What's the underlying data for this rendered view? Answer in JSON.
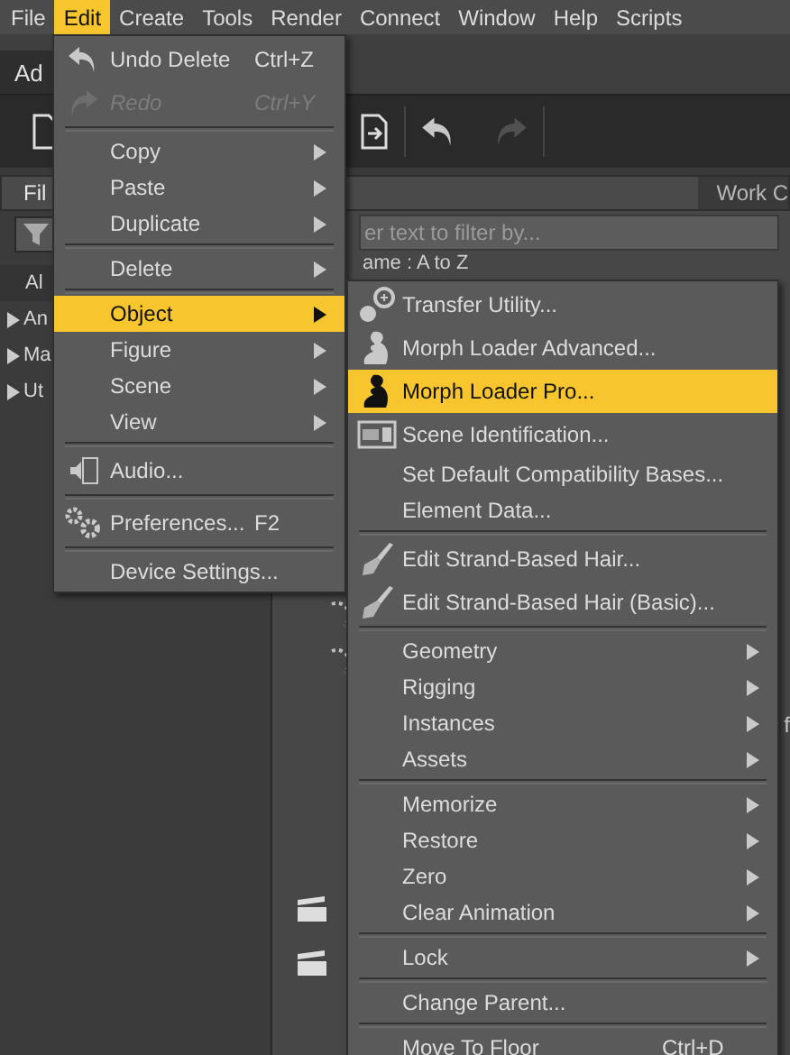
{
  "menu_bar": [
    {
      "label": "File",
      "selected": false
    },
    {
      "label": "Edit",
      "selected": true
    },
    {
      "label": "Create",
      "selected": false
    },
    {
      "label": "Tools",
      "selected": false
    },
    {
      "label": "Render",
      "selected": false
    },
    {
      "label": "Connect",
      "selected": false
    },
    {
      "label": "Window",
      "selected": false
    },
    {
      "label": "Help",
      "selected": false
    },
    {
      "label": "Scripts",
      "selected": false
    }
  ],
  "workspace": {
    "tab": "Ad",
    "panel_tabs": [
      {
        "label": "Fil",
        "selected": true
      },
      {
        "label": "Work C",
        "selected": false
      }
    ],
    "filter_placeholder": "er text to filter by...",
    "sort_label": "ame : A to Z",
    "tree_items": [
      {
        "label": "Al",
        "expandable": false
      },
      {
        "label": "An",
        "expandable": true
      },
      {
        "label": "Ma",
        "expandable": true
      },
      {
        "label": "Ut",
        "expandable": true
      }
    ],
    "edge_text": "f"
  },
  "edit_menu": {
    "items": [
      {
        "kind": "item",
        "label": "Undo Delete",
        "shortcut": "Ctrl+Z",
        "disabled": false,
        "selected": false,
        "submenu": false
      },
      {
        "kind": "item",
        "label": "Redo",
        "shortcut": "Ctrl+Y",
        "disabled": true,
        "selected": false,
        "submenu": false
      },
      {
        "kind": "separator"
      },
      {
        "kind": "item",
        "label": "Copy",
        "disabled": false,
        "selected": false,
        "submenu": true
      },
      {
        "kind": "item",
        "label": "Paste",
        "disabled": false,
        "selected": false,
        "submenu": true
      },
      {
        "kind": "item",
        "label": "Duplicate",
        "disabled": false,
        "selected": false,
        "submenu": true
      },
      {
        "kind": "separator"
      },
      {
        "kind": "item",
        "label": "Delete",
        "disabled": false,
        "selected": false,
        "submenu": true
      },
      {
        "kind": "separator"
      },
      {
        "kind": "item",
        "label": "Object",
        "disabled": false,
        "selected": true,
        "submenu": true
      },
      {
        "kind": "item",
        "label": "Figure",
        "disabled": false,
        "selected": false,
        "submenu": true
      },
      {
        "kind": "item",
        "label": "Scene",
        "disabled": false,
        "selected": false,
        "submenu": true
      },
      {
        "kind": "item",
        "label": "View",
        "disabled": false,
        "selected": false,
        "submenu": true
      },
      {
        "kind": "separator"
      },
      {
        "kind": "item",
        "label": "Audio...",
        "disabled": false,
        "selected": false,
        "submenu": false
      },
      {
        "kind": "separator"
      },
      {
        "kind": "item",
        "label": "Preferences...",
        "shortcut": "F2",
        "disabled": false,
        "selected": false,
        "submenu": false
      },
      {
        "kind": "separator"
      },
      {
        "kind": "item",
        "label": "Device Settings...",
        "disabled": false,
        "selected": false,
        "submenu": false
      }
    ]
  },
  "object_submenu": {
    "items": [
      {
        "kind": "item",
        "label": "Transfer Utility...",
        "disabled": false,
        "selected": false,
        "submenu": false
      },
      {
        "kind": "item",
        "label": "Morph Loader Advanced...",
        "disabled": false,
        "selected": false,
        "submenu": false
      },
      {
        "kind": "item",
        "label": "Morph Loader Pro...",
        "disabled": false,
        "selected": true,
        "submenu": false
      },
      {
        "kind": "item",
        "label": "Scene Identification...",
        "disabled": false,
        "selected": false,
        "submenu": false
      },
      {
        "kind": "item",
        "label": "Set Default Compatibility Bases...",
        "disabled": false,
        "selected": false,
        "submenu": false
      },
      {
        "kind": "item",
        "label": "Element Data...",
        "disabled": false,
        "selected": false,
        "submenu": false
      },
      {
        "kind": "separator"
      },
      {
        "kind": "item",
        "label": "Edit Strand-Based Hair...",
        "disabled": false,
        "selected": false,
        "submenu": false
      },
      {
        "kind": "item",
        "label": "Edit Strand-Based Hair (Basic)...",
        "disabled": false,
        "selected": false,
        "submenu": false
      },
      {
        "kind": "separator"
      },
      {
        "kind": "item",
        "label": "Geometry",
        "disabled": false,
        "selected": false,
        "submenu": true
      },
      {
        "kind": "item",
        "label": "Rigging",
        "disabled": false,
        "selected": false,
        "submenu": true
      },
      {
        "kind": "item",
        "label": "Instances",
        "disabled": false,
        "selected": false,
        "submenu": true
      },
      {
        "kind": "item",
        "label": "Assets",
        "disabled": false,
        "selected": false,
        "submenu": true
      },
      {
        "kind": "separator"
      },
      {
        "kind": "item",
        "label": "Memorize",
        "disabled": false,
        "selected": false,
        "submenu": true
      },
      {
        "kind": "item",
        "label": "Restore",
        "disabled": false,
        "selected": false,
        "submenu": true
      },
      {
        "kind": "item",
        "label": "Zero",
        "disabled": false,
        "selected": false,
        "submenu": true
      },
      {
        "kind": "item",
        "label": "Clear Animation",
        "disabled": false,
        "selected": false,
        "submenu": true
      },
      {
        "kind": "separator"
      },
      {
        "kind": "item",
        "label": "Lock",
        "disabled": false,
        "selected": false,
        "submenu": true
      },
      {
        "kind": "separator"
      },
      {
        "kind": "item",
        "label": "Change Parent...",
        "disabled": false,
        "selected": false,
        "submenu": false
      },
      {
        "kind": "separator"
      },
      {
        "kind": "item",
        "label": "Move To Floor",
        "shortcut": "Ctrl+D",
        "disabled": false,
        "selected": false,
        "submenu": false
      }
    ]
  }
}
